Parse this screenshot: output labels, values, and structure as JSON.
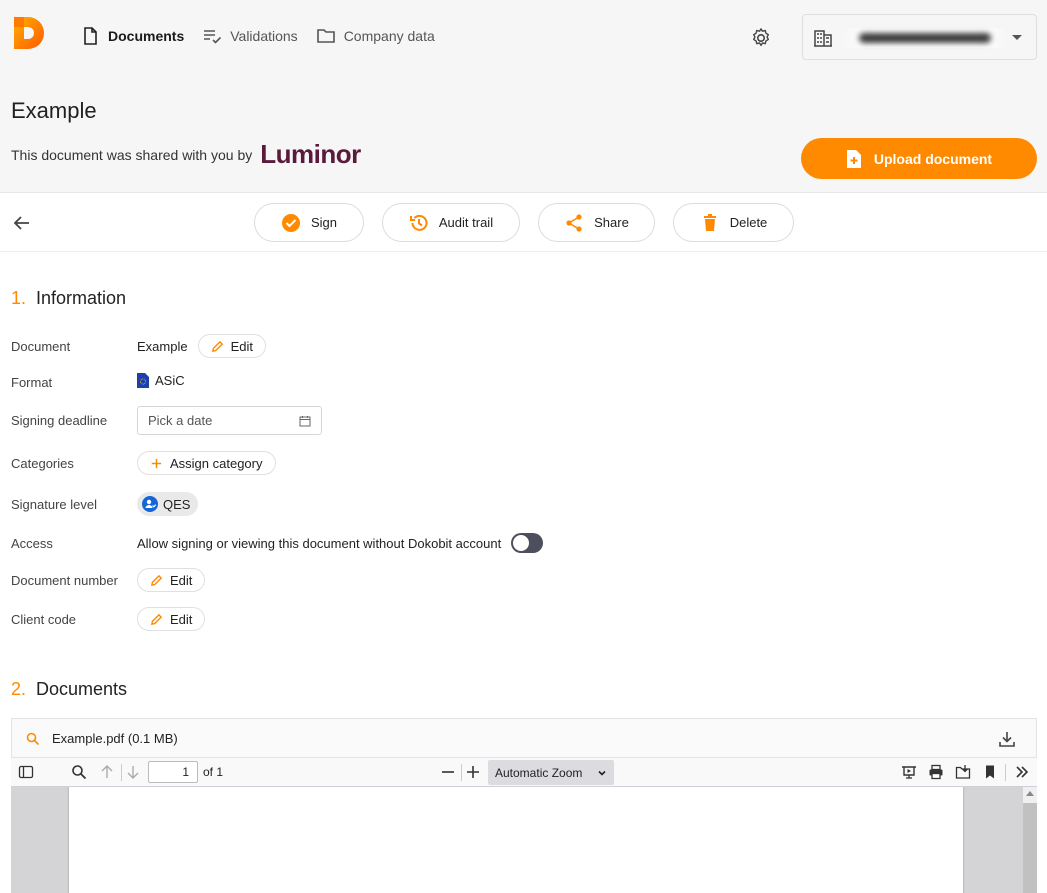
{
  "nav": {
    "items": [
      {
        "label": "Documents",
        "icon": "document-icon",
        "active": true
      },
      {
        "label": "Validations",
        "icon": "checklist-icon",
        "active": false
      },
      {
        "label": "Company data",
        "icon": "folder-icon",
        "active": false
      }
    ]
  },
  "header": {
    "title": "Example",
    "shared_text": "This document was shared with you by",
    "shared_by_brand": "Luminor",
    "upload_label": "Upload document"
  },
  "actions": {
    "sign": "Sign",
    "audit_trail": "Audit trail",
    "share": "Share",
    "delete": "Delete"
  },
  "information": {
    "number": "1.",
    "title": "Information",
    "document_label": "Document",
    "document_value": "Example",
    "edit_label": "Edit",
    "format_label": "Format",
    "format_value": "ASiC",
    "deadline_label": "Signing deadline",
    "deadline_placeholder": "Pick a date",
    "categories_label": "Categories",
    "assign_category": "Assign category",
    "signature_level_label": "Signature level",
    "signature_level_value": "QES",
    "access_label": "Access",
    "access_text": "Allow signing or viewing this document without Dokobit account",
    "document_number_label": "Document number",
    "client_code_label": "Client code"
  },
  "documents": {
    "number": "2.",
    "title": "Documents",
    "file_name": "Example.pdf (0.1 MB)",
    "page_current": "1",
    "page_of": "of 1",
    "zoom": "Automatic Zoom"
  },
  "colors": {
    "accent": "#ff8a00",
    "brand": "#5a1a3c",
    "toggle_off": "#4d4f5c"
  }
}
